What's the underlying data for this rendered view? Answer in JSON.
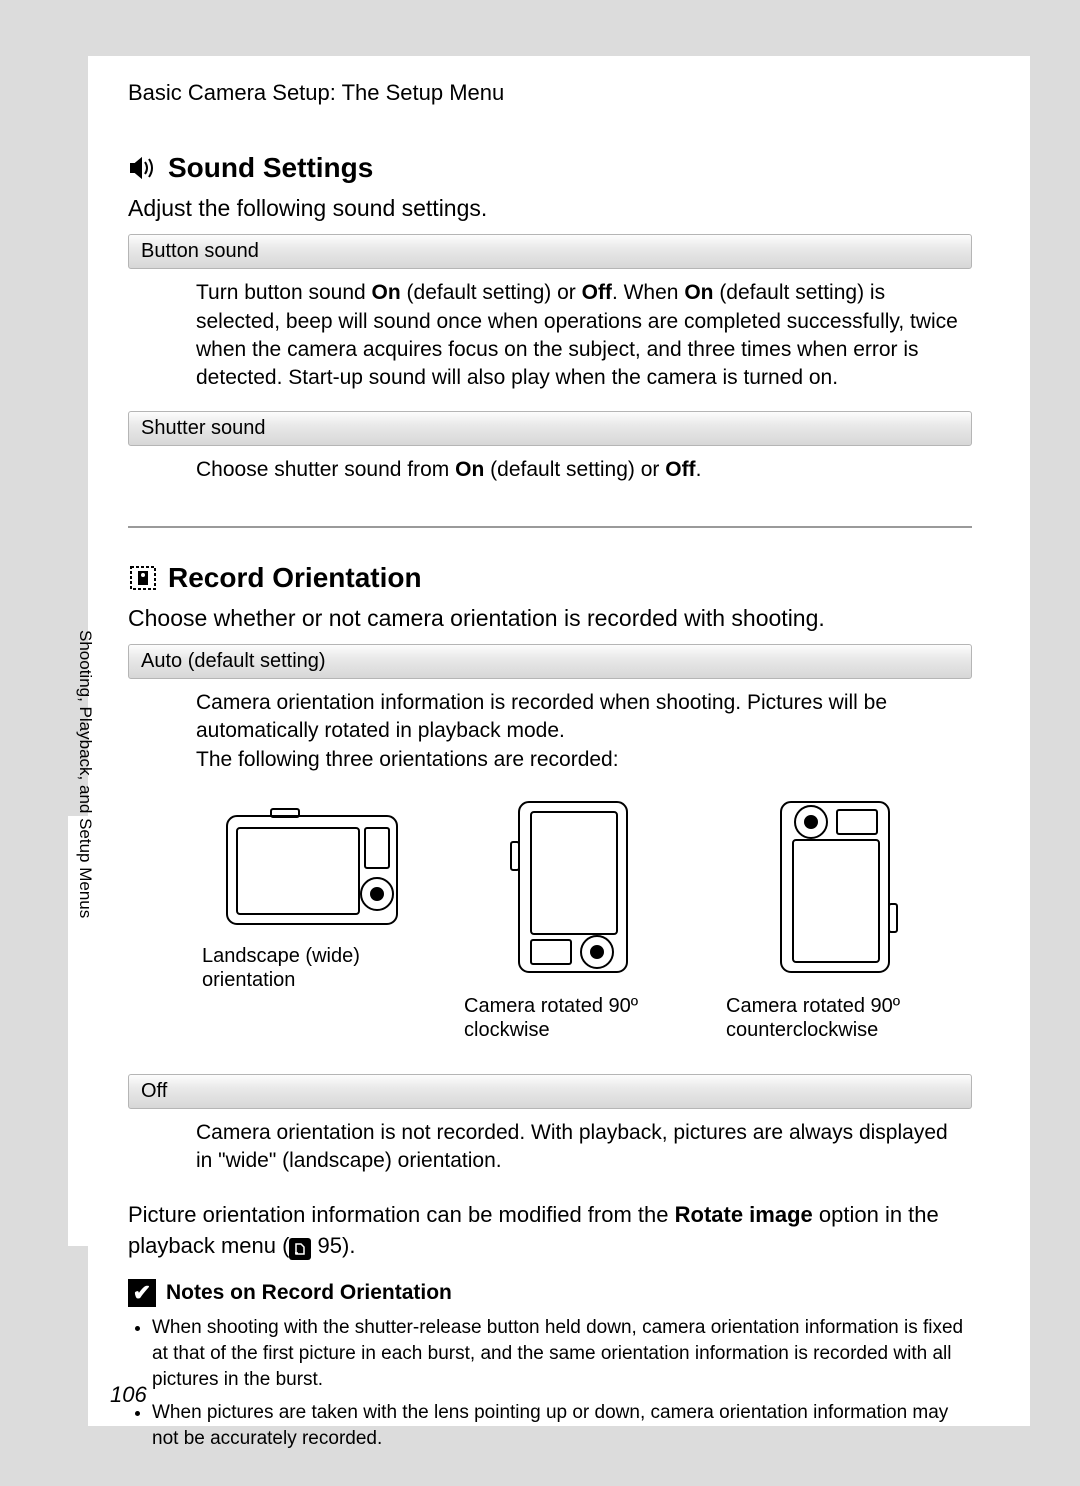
{
  "running_head": "Basic Camera Setup: The Setup Menu",
  "side_tab": "Shooting, Playback, and Setup Menus",
  "page_number": "106",
  "sound": {
    "title": "Sound Settings",
    "intro": "Adjust the following sound settings.",
    "options": [
      {
        "head": "Button sound",
        "body_pre": "Turn button sound ",
        "b1": "On",
        "mid1": " (default setting) or ",
        "b2": "Off",
        "mid2": ". When ",
        "b3": "On",
        "tail": " (default setting) is selected, beep will sound once when operations are completed successfully, twice when the camera acquires focus on the subject, and three times when error is detected. Start-up sound will also play when the camera is turned on."
      },
      {
        "head": "Shutter sound",
        "body_pre": "Choose shutter sound from ",
        "b1": "On",
        "mid1": " (default setting) or ",
        "b2": "Off",
        "tail2": "."
      }
    ]
  },
  "record": {
    "title": "Record Orientation",
    "intro": "Choose whether or not camera orientation is recorded with shooting.",
    "auto": {
      "head": "Auto (default setting)",
      "body1": "Camera orientation information is recorded when shooting. Pictures will be automatically rotated in playback mode.",
      "body2": "The following three orientations are recorded:",
      "captions": [
        "Landscape (wide) orientation",
        "Camera rotated 90º clockwise",
        "Camera rotated 90º counterclockwise"
      ]
    },
    "off": {
      "head": "Off",
      "body": "Camera orientation is not recorded. With playback, pictures are always displayed in \"wide\" (landscape) orientation."
    },
    "crossref_pre": "Picture orientation information can be modified from the ",
    "crossref_b": "Rotate image",
    "crossref_mid": " option in the playback menu (",
    "crossref_page": " 95).",
    "notes_title": "Notes on Record Orientation",
    "notes": [
      "When shooting with the shutter-release button held down, camera orientation information is fixed at that of the first picture in each burst, and the same orientation information is recorded with all pictures in the burst.",
      "When pictures are taken with the lens pointing up or down, camera orientation information may not be accurately recorded."
    ]
  }
}
